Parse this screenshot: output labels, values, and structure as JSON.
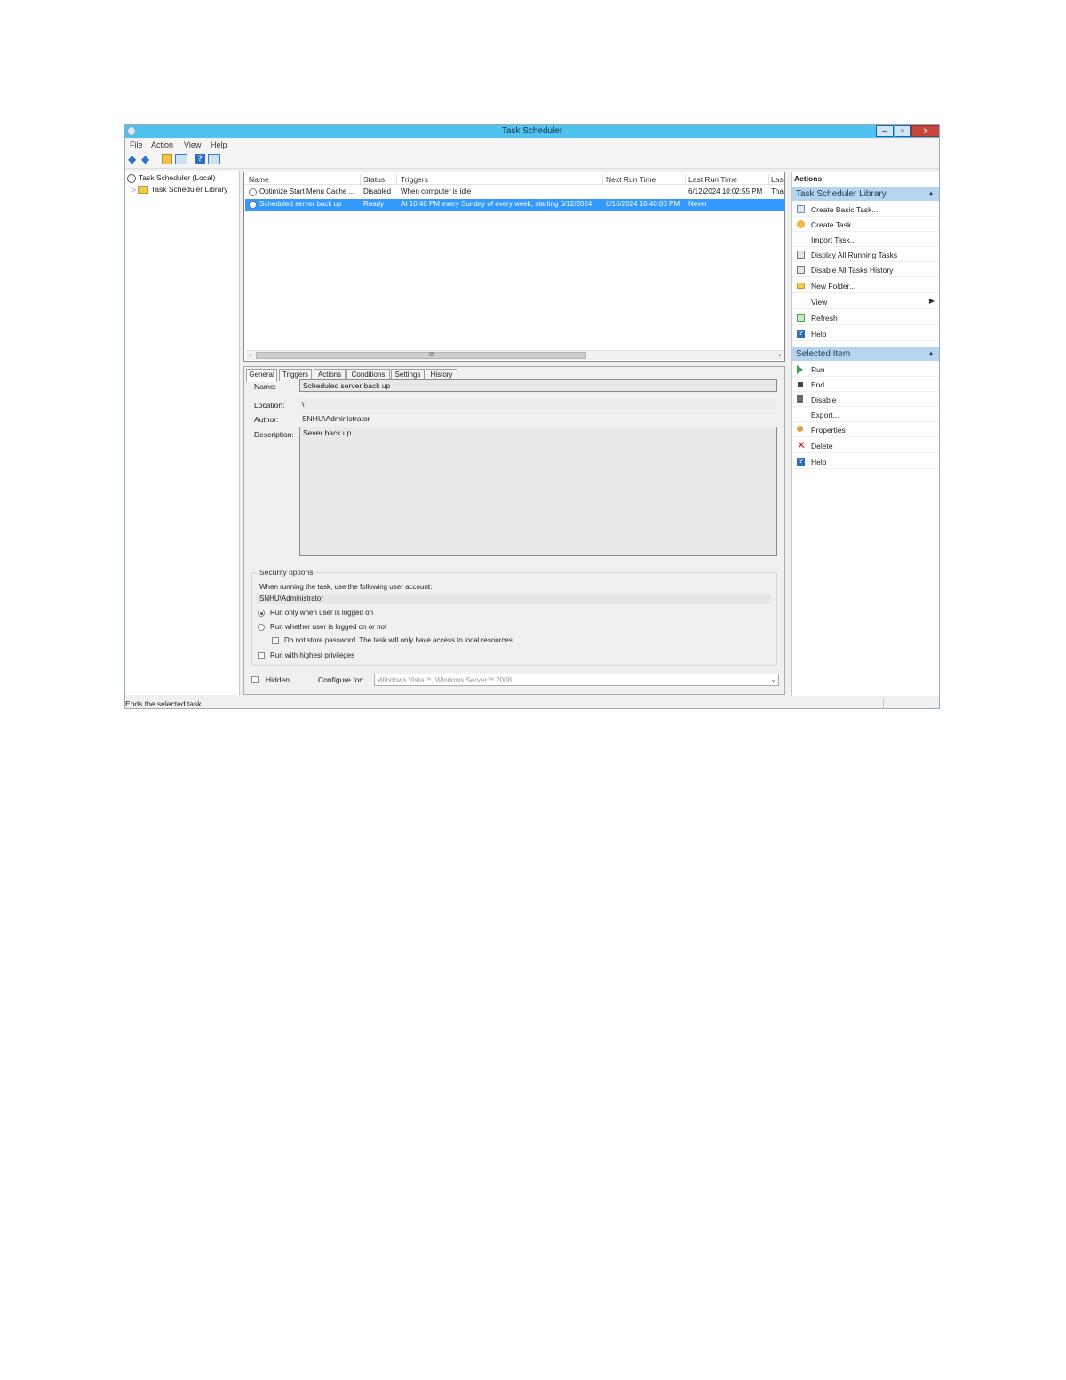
{
  "window": {
    "title": "Task Scheduler"
  },
  "menu": [
    "File",
    "Action",
    "View",
    "Help"
  ],
  "tree": {
    "root": "Task Scheduler (Local)",
    "library": "Task Scheduler Library"
  },
  "task_list": {
    "columns": [
      "Name",
      "Status",
      "Triggers",
      "Next Run Time",
      "Last Run Time",
      "Las"
    ],
    "rows": [
      {
        "name": "Optimize Start Menu Cache ...",
        "status": "Disabled",
        "triggers": "When computer is idle",
        "next_run": "",
        "last_run": "6/12/2024 10:02:55 PM",
        "last_result": "Tha",
        "selected": false
      },
      {
        "name": "Scheduled server back up",
        "status": "Ready",
        "triggers": "At 10:40 PM every Sunday of every week, starting 6/12/2024",
        "next_run": "6/16/2024 10:40:00 PM",
        "last_run": "Never",
        "last_result": "",
        "selected": true
      }
    ],
    "scroll_grip": "III"
  },
  "tabs": [
    "General",
    "Triggers",
    "Actions",
    "Conditions",
    "Settings",
    "History"
  ],
  "general": {
    "name_label": "Name:",
    "name_value": "Scheduled server back up",
    "location_label": "Location:",
    "location_value": "\\",
    "author_label": "Author:",
    "author_value": "SNHU\\Administrator",
    "description_label": "Description:",
    "description_value": "Sever back up"
  },
  "security": {
    "legend": "Security options",
    "account_prompt": "When running the task, use the following user account:",
    "account": "SNHU\\Administrator",
    "opt_logged_on": "Run only when user is logged on",
    "opt_whether": "Run whether user is logged on or not",
    "opt_no_password": "Do not store password.  The task will only have access to local resources",
    "opt_highest": "Run with highest privileges"
  },
  "bottom": {
    "hidden_label": "Hidden",
    "configure_label": "Configure for:",
    "configure_value": "Windows Vista™, Windows Server™ 2008"
  },
  "actions_pane": {
    "header": "Actions",
    "library_section": "Task Scheduler Library",
    "library_items": [
      "Create Basic Task...",
      "Create Task...",
      "Import Task...",
      "Display All Running Tasks",
      "Disable All Tasks History",
      "New Folder...",
      "View",
      "Refresh",
      "Help"
    ],
    "selected_section": "Selected Item",
    "selected_items": [
      "Run",
      "End",
      "Disable",
      "Export...",
      "Properties",
      "Delete",
      "Help"
    ]
  },
  "status_bar": {
    "text": "Ends the selected task."
  }
}
